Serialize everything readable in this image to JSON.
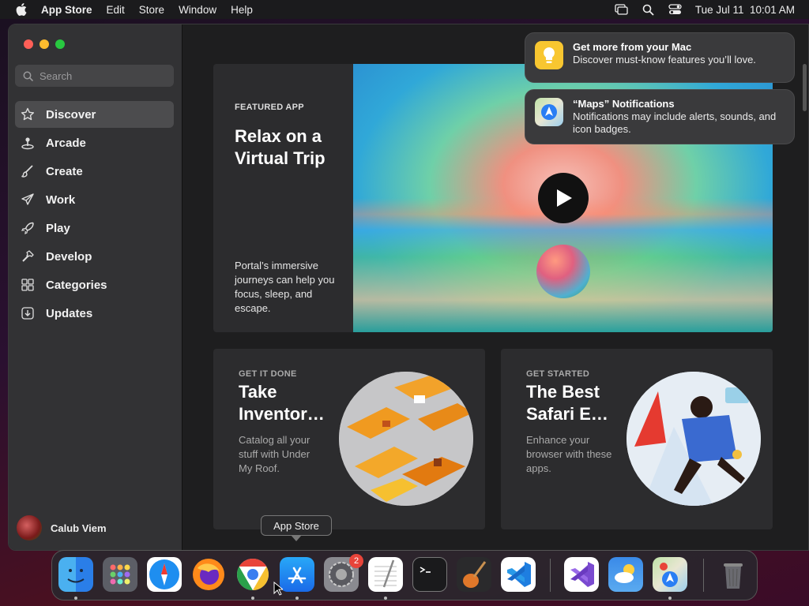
{
  "menubar": {
    "app_name": "App Store",
    "menus": [
      "Edit",
      "Store",
      "Window",
      "Help"
    ],
    "datetime": "Tue Jul 11  10:01 AM"
  },
  "sidebar": {
    "search_placeholder": "Search",
    "items": [
      {
        "label": "Discover",
        "icon": "star-icon",
        "active": true
      },
      {
        "label": "Arcade",
        "icon": "joystick-icon"
      },
      {
        "label": "Create",
        "icon": "paintbrush-icon"
      },
      {
        "label": "Work",
        "icon": "paperplane-icon"
      },
      {
        "label": "Play",
        "icon": "rocket-icon"
      },
      {
        "label": "Develop",
        "icon": "hammer-icon"
      },
      {
        "label": "Categories",
        "icon": "grid-icon"
      },
      {
        "label": "Updates",
        "icon": "download-icon"
      }
    ],
    "user_name": "Calub Viem"
  },
  "hero": {
    "eyebrow": "FEATURED APP",
    "title": "Relax on a Virtual Trip",
    "description": "Portal’s immersive journeys can help you focus, sleep, and escape."
  },
  "cards": [
    {
      "eyebrow": "GET IT DONE",
      "title": "Take Inventor…",
      "description": "Catalog all your stuff with Under My Roof."
    },
    {
      "eyebrow": "GET STARTED",
      "title": "The Best Safari E…",
      "description": "Enhance your browser with these apps."
    }
  ],
  "notifications": [
    {
      "title": "Get more from your Mac",
      "body": "Discover must-know features you’ll love."
    },
    {
      "title": "“Maps” Notifications",
      "body": "Notifications may include alerts, sounds, and icon badges."
    }
  ],
  "dock": {
    "tooltip": "App Store",
    "settings_badge": "2",
    "apps": [
      "Finder",
      "Launchpad",
      "Safari",
      "Firefox",
      "Chrome",
      "App Store",
      "System Settings",
      "TextEdit",
      "Terminal",
      "GarageBand",
      "VS Code",
      "Visual Studio",
      "Weather",
      "Maps",
      "Trash"
    ]
  }
}
